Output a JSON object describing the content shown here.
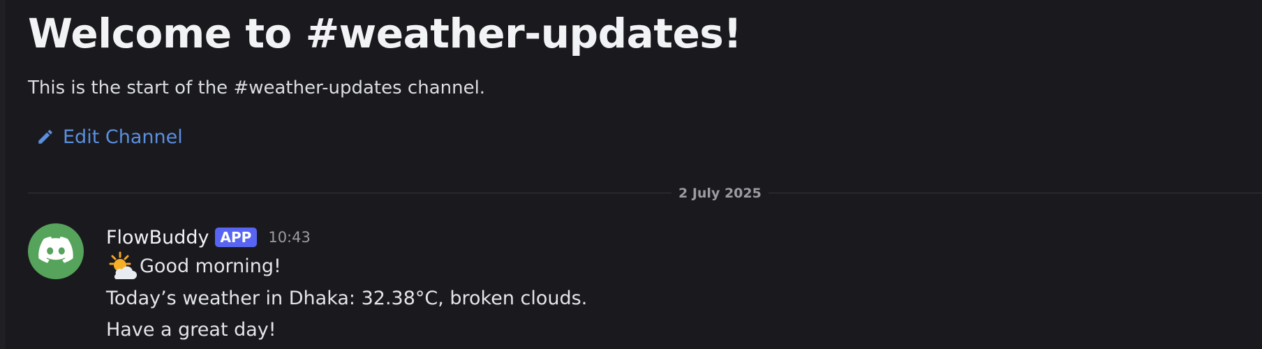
{
  "channel": {
    "welcome_title": "Welcome to #weather-updates!",
    "welcome_subtitle": "This is the start of the #weather-updates channel.",
    "edit_channel_label": "Edit Channel"
  },
  "divider": {
    "date": "2 July 2025"
  },
  "message": {
    "author": "FlowBuddy",
    "badge": "APP",
    "time": "10:43",
    "emoji": "sun-behind-cloud-icon",
    "lines": [
      "Good morning!",
      "Today’s weather in Dhaka: 32.38°C, broken clouds.",
      "Have a great day!"
    ]
  },
  "colors": {
    "background": "#1a1a1e",
    "link": "#5b8fe0",
    "badge": "#5865f2",
    "avatar": "#56a35b"
  }
}
